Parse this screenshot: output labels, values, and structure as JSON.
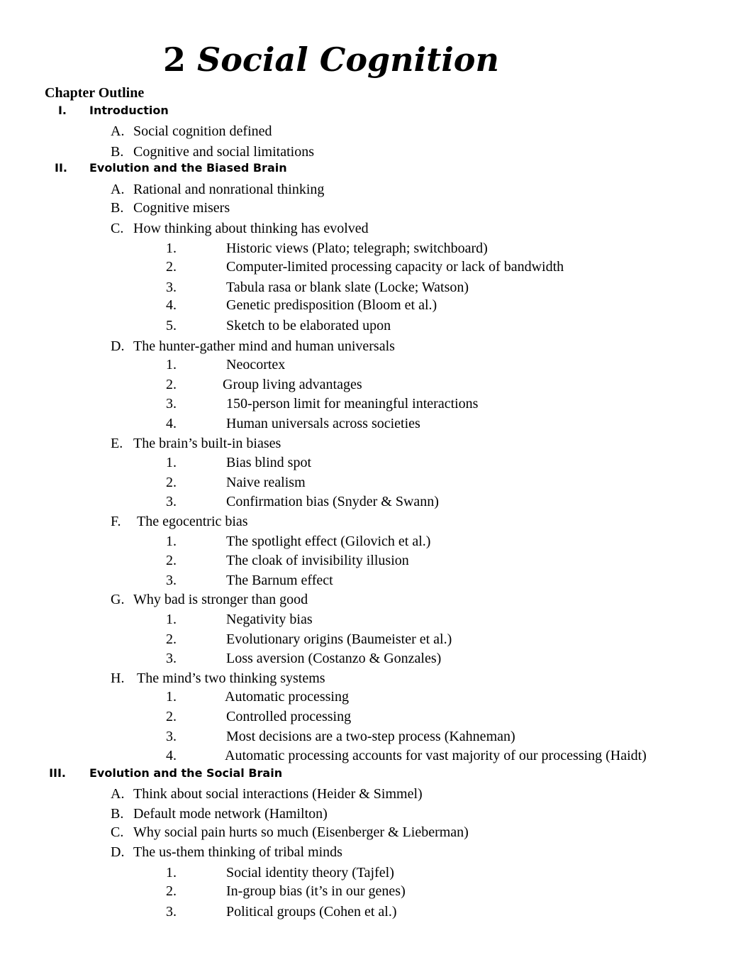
{
  "document": {
    "title_number": "2",
    "title_text": "Social Cognition",
    "outline_heading": "Chapter Outline",
    "sections": [
      {
        "numeral": "I.",
        "label": "Introduction",
        "items": [
          {
            "letter": "A.",
            "label": "Social cognition defined",
            "subitems": []
          },
          {
            "letter": "B.",
            "label": "Cognitive and social limitations",
            "subitems": []
          }
        ]
      },
      {
        "numeral": "II.",
        "label": "Evolution and the Biased Brain",
        "items": [
          {
            "letter": "A.",
            "label": "Rational and nonrational thinking",
            "subitems": []
          },
          {
            "letter": "B.",
            "label": "Cognitive misers",
            "subitems": []
          },
          {
            "letter": "C.",
            "label": "How thinking about thinking has evolved",
            "subitems": [
              {
                "num": "1.",
                "label": "Historic views (Plato; telegraph; switchboard)"
              },
              {
                "num": "2.",
                "label": "Computer-limited processing capacity or lack of bandwidth"
              },
              {
                "num": "3.",
                "label": "Tabula rasa or blank slate (Locke; Watson)"
              },
              {
                "num": "4.",
                "label": "Genetic predisposition (Bloom et al.)"
              },
              {
                "num": "5.",
                "label": "Sketch to be elaborated upon"
              }
            ]
          },
          {
            "letter": "D.",
            "label": "The hunter-gather mind and human universals",
            "subitems": [
              {
                "num": "1.",
                "label": "Neocortex"
              },
              {
                "num": "2.",
                "label": "Group living advantages"
              },
              {
                "num": "3.",
                "label": "150-person limit for meaningful interactions"
              },
              {
                "num": "4.",
                "label": "Human universals across societies"
              }
            ]
          },
          {
            "letter": "E.",
            "label": "The brain’s built-in biases",
            "subitems": [
              {
                "num": "1.",
                "label": "Bias blind spot"
              },
              {
                "num": "2.",
                "label": "Naive realism"
              },
              {
                "num": "3.",
                "label": "Confirmation bias (Snyder & Swann)"
              }
            ]
          },
          {
            "letter": "F.",
            "label": "The egocentric bias",
            "subitems": [
              {
                "num": "1.",
                "label": "The spotlight effect (Gilovich et al.)"
              },
              {
                "num": "2.",
                "label": "The cloak of invisibility illusion"
              },
              {
                "num": "3.",
                "label": "The Barnum effect"
              }
            ]
          },
          {
            "letter": "G.",
            "label": "Why bad is stronger than good",
            "subitems": [
              {
                "num": "1.",
                "label": "Negativity bias"
              },
              {
                "num": "2.",
                "label": "Evolutionary origins (Baumeister et al.)"
              },
              {
                "num": "3.",
                "label": "Loss aversion (Costanzo & Gonzales)"
              }
            ]
          },
          {
            "letter": "H.",
            "label": "The mind’s two thinking systems",
            "subitems": [
              {
                "num": "1.",
                "label": "Automatic processing"
              },
              {
                "num": "2.",
                "label": "Controlled processing"
              },
              {
                "num": "3.",
                "label": "Most decisions are a two-step process (Kahneman)"
              },
              {
                "num": "4.",
                "label": "Automatic processing accounts for vast majority of our processing (Haidt)"
              }
            ]
          }
        ]
      },
      {
        "numeral": "III.",
        "label": "Evolution and the Social Brain",
        "items": [
          {
            "letter": "A.",
            "label": "Think about social interactions (Heider & Simmel)",
            "subitems": []
          },
          {
            "letter": "B.",
            "label": "Default mode network (Hamilton)",
            "subitems": []
          },
          {
            "letter": "C.",
            "label": "Why social pain hurts so much (Eisenberger & Lieberman)",
            "subitems": []
          },
          {
            "letter": "D.",
            "label": "The us-them thinking of tribal minds",
            "subitems": [
              {
                "num": "1.",
                "label": "Social identity theory (Tajfel)"
              },
              {
                "num": "2.",
                "label": "In-group bias (it’s in our genes)"
              },
              {
                "num": "3.",
                "label": "Political groups (Cohen et al.)"
              }
            ]
          }
        ]
      }
    ]
  }
}
